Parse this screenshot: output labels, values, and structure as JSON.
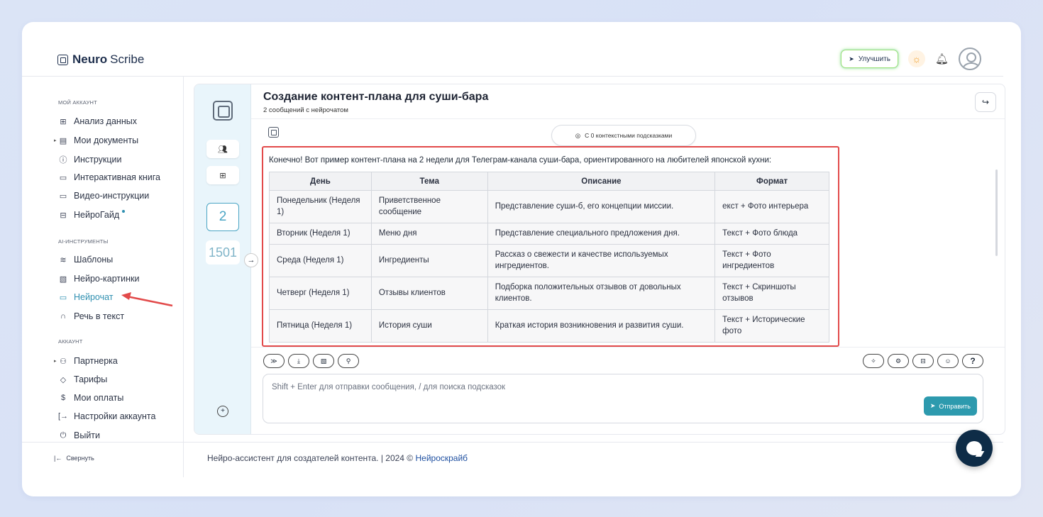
{
  "header": {
    "logo_bold": "Neuro",
    "logo_light": "Scribe",
    "upgrade_label": "Улучшить"
  },
  "sidebar": {
    "sections": [
      {
        "title": "МОЙ АККАУНТ"
      },
      {
        "title": "AI-ИНСТРУМЕНТЫ"
      },
      {
        "title": "АККАУНТ"
      }
    ],
    "account_items": [
      "Анализ данных",
      "Мои документы",
      "Инструкции",
      "Интерактивная книга",
      "Видео-инструкции",
      "НейроГайд"
    ],
    "ai_items": [
      "Шаблоны",
      "Нейро-картинки",
      "Нейрочат",
      "Речь в текст"
    ],
    "settings_items": [
      "Партнерка",
      "Тарифы",
      "Мои оплаты",
      "Настройки аккаунта",
      "Выйти"
    ],
    "collapse_label": "Свернуть",
    "active_item": "Нейрочат"
  },
  "footer": {
    "text": "Нейро-ассистент для создателей контента.  | 2024 © ",
    "link": "Нейроскрайб"
  },
  "rail": {
    "count": "2",
    "number": "1501"
  },
  "chat": {
    "title": "Создание контент-плана для суши-бара",
    "subtitle": "2 сообщений с нейрочатом",
    "hints_label": "С 0 контекстными подсказками",
    "intro": "Конечно! Вот пример контент-плана на 2 недели для Телеграм-канала суши-бара, ориентированного на любителей японской кухни:",
    "table": {
      "headers": [
        "День",
        "Тема",
        "Описание",
        "Формат"
      ],
      "rows": [
        [
          "Понедельник (Неделя 1)",
          "Приветственное сообщение",
          "Представление суши-б, его концепции миссии.",
          "екст + Фото интерьера"
        ],
        [
          "Вторник (Неделя 1)",
          "Меню дня",
          "Представление специального предложения дня.",
          "Текст + Фото блюда"
        ],
        [
          "Среда (Неделя 1)",
          "Ингредиенты",
          "Рассказ о свежести и качестве используемых ингредиентов.",
          "Текст + Фото ингредиентов"
        ],
        [
          "Четверг (Неделя 1)",
          "Отзывы клиентов",
          "Подборка положительных отзывов от довольных клиентов.",
          "Текст + Скриншоты отзывов"
        ],
        [
          "Пятница (Неделя 1)",
          "История суши",
          "Краткая история возникновения и развития суши.",
          "Текст + Исторические фото"
        ]
      ]
    },
    "input_placeholder": "Shift + Enter для отправки сообщения, / для поиска подсказок",
    "send_label": "Отправить",
    "help_label": "?"
  },
  "colors": {
    "accent": "#2d9aae",
    "highlight": "#e24a4a",
    "fab": "#0e2c47"
  }
}
